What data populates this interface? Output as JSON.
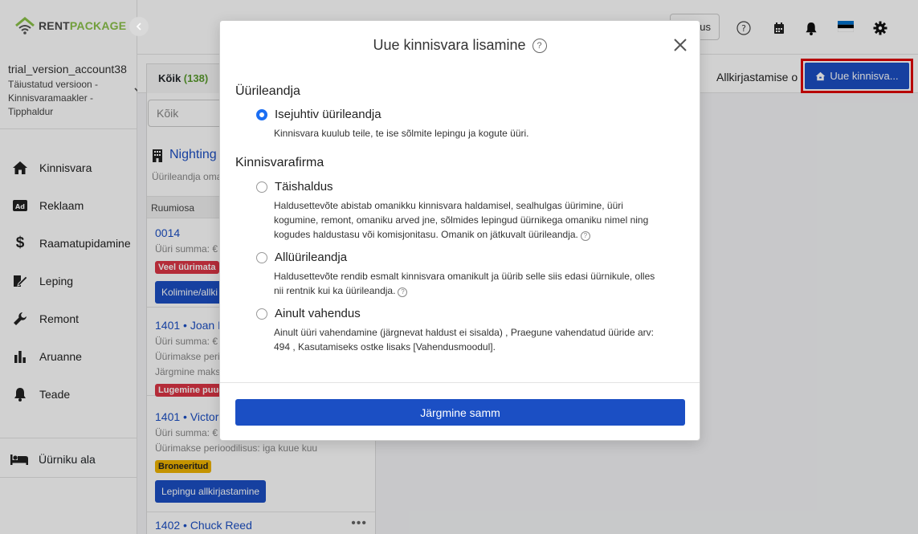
{
  "brand": {
    "rent": "RENT",
    "package": "PACKAGE"
  },
  "account": {
    "name": "trial_version_account38",
    "description": "Täiustatud versioon - Kinnisvaramaakler - Tipphaldur"
  },
  "nav": [
    {
      "label": "Kinnisvara",
      "icon": "home-icon"
    },
    {
      "label": "Reklaam",
      "icon": "ad-icon"
    },
    {
      "label": "Raamatupidamine",
      "icon": "dollar-icon"
    },
    {
      "label": "Leping",
      "icon": "contract-sign-icon"
    },
    {
      "label": "Remont",
      "icon": "wrench-icon"
    },
    {
      "label": "Aruanne",
      "icon": "bar-chart-icon"
    },
    {
      "label": "Teade",
      "icon": "bell-icon"
    }
  ],
  "tenant_area": {
    "label": "Üürniku ala"
  },
  "topbar": {
    "partial_button": "us"
  },
  "filter": {
    "all_tab": "Kõik",
    "all_count": "(138)",
    "sign_tab": "Allkirjastamise o",
    "new_button": "Uue kinnisva..."
  },
  "list": {
    "search_placeholder": "Kõik",
    "property_name": "Nighting",
    "property_sub": "Üürileandja oma",
    "units_header": "Ruumiosa",
    "units": [
      {
        "title": "0014",
        "lines": [
          "Üüri summa: €"
        ],
        "badge": "Veel üürimata",
        "badge_color": "#dc3545",
        "button": "Kolimine/allki"
      },
      {
        "title": "1401 • Joan R",
        "lines": [
          "Üüri summa: €",
          "Üürimakse perio",
          "Järgmine maks"
        ],
        "badge": "Lugemine puud",
        "badge_color": "#dc3545"
      },
      {
        "title": "1401 • Victor",
        "lines": [
          "Üüri summa: €",
          "Üürimakse perioodilisus: iga kuue kuu"
        ],
        "badge": "Broneeritud",
        "badge_color": "#f0b400",
        "button": "Lepingu allkirjastamine"
      },
      {
        "title": "1402 • Chuck Reed",
        "lines": []
      }
    ]
  },
  "modal": {
    "title": "Uue kinnisvara lisamine",
    "section1": "Üürileandja",
    "section2": "Kinnisvarafirma",
    "options": [
      {
        "label": "Isejuhtiv üürileandja",
        "selected": true,
        "desc": "Kinnisvara kuulub teile, te ise sõlmite lepingu ja kogute üüri."
      },
      {
        "label": "Täishaldus",
        "selected": false,
        "desc": "Haldusettevõte abistab omanikku kinnisvara haldamisel, sealhulgas üürimine, üüri kogumine, remont, omaniku arved jne, sõlmides lepingud üürnikega omaniku nimel ning kogudes haldustasu või komisjonitasu. Omanik on jätkuvalt üürileandja."
      },
      {
        "label": "Allüürileandja",
        "selected": false,
        "desc": "Haldusettevõte rendib esmalt kinnisvara omanikult ja üürib selle siis edasi üürnikule, olles nii rentnik kui ka üürileandja."
      },
      {
        "label": "Ainult vahendus",
        "selected": false,
        "desc": "Ainult üüri vahendamine (järgnevat haldust ei sisalda) , Praegune vahendatud üüride arv: 494 , Kasutamiseks ostke lisaks [Vahendusmoodul]."
      }
    ],
    "next_button": "Järgmine samm"
  }
}
